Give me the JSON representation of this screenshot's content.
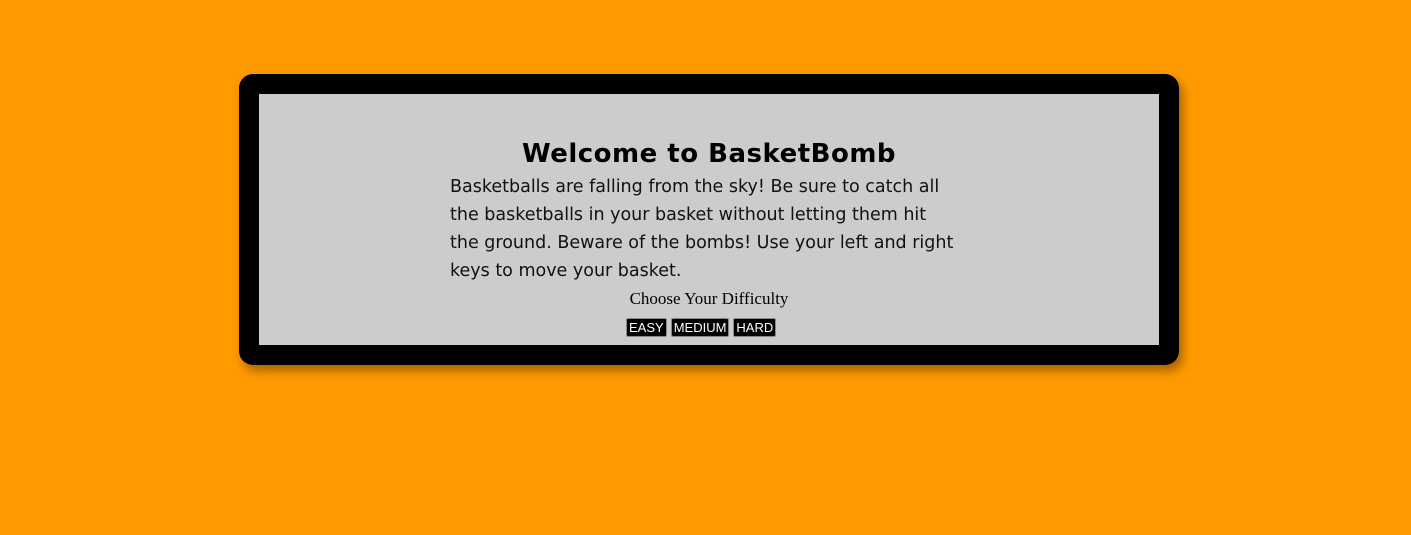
{
  "page": {
    "background_color": "#ff9a00",
    "frame_color": "#000000",
    "panel_color": "#cccccc"
  },
  "welcome": {
    "title": "Welcome to BasketBomb",
    "description": "Basketballs are falling from the sky! Be sure to catch all the basketballs in your basket without letting them hit the ground. Beware of the bombs! Use your left and right keys to move your basket."
  },
  "difficulty": {
    "label": "Choose Your Difficulty",
    "options": {
      "easy": "EASY",
      "medium": "MEDIUM",
      "hard": "HARD"
    }
  }
}
